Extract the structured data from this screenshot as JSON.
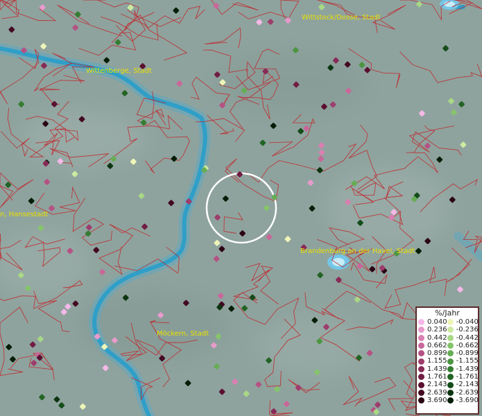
{
  "map": {
    "place_labels": [
      {
        "id": "wittstock",
        "text": "Wittstock/Dosse, Stadt"
      },
      {
        "id": "wittenberge",
        "text": "Wittenberge, Stadt"
      },
      {
        "id": "hansestadt",
        "text": "n, Hansestadt"
      },
      {
        "id": "brandenburg",
        "text": "Brandenburg an der Havel, Stadt"
      },
      {
        "id": "moeckern",
        "text": "Möckern, Stadt"
      }
    ]
  },
  "legend": {
    "title": "%/Jahr",
    "positive": [
      {
        "label": "0.040",
        "color": "#f5b8e8"
      },
      {
        "label": "0.236",
        "color": "#e79acb"
      },
      {
        "label": "0.442",
        "color": "#d97fb2"
      },
      {
        "label": "0.662",
        "color": "#c8689a"
      },
      {
        "label": "0.899",
        "color": "#b55283"
      },
      {
        "label": "1.155",
        "color": "#9e3d6c"
      },
      {
        "label": "1.439",
        "color": "#882b57"
      },
      {
        "label": "1.761",
        "color": "#711c43"
      },
      {
        "label": "2.143",
        "color": "#5a1031"
      },
      {
        "label": "2.639",
        "color": "#430822"
      },
      {
        "label": "3.690",
        "color": "#2a0313"
      }
    ],
    "negative": [
      {
        "label": "-0.040",
        "color": "#eef5b8"
      },
      {
        "label": "-0.236",
        "color": "#cdeaa0"
      },
      {
        "label": "-0.442",
        "color": "#a9d886"
      },
      {
        "label": "-0.662",
        "color": "#86c46c"
      },
      {
        "label": "-0.899",
        "color": "#66ad55"
      },
      {
        "label": "-1.155",
        "color": "#4c9542"
      },
      {
        "label": "-1.439",
        "color": "#357d32"
      },
      {
        "label": "-1.761",
        "color": "#236425"
      },
      {
        "label": "-2.143",
        "color": "#144c1a"
      },
      {
        "label": "-2.639",
        "color": "#0a3510"
      },
      {
        "label": "-3.690",
        "color": "#031e07"
      }
    ]
  }
}
